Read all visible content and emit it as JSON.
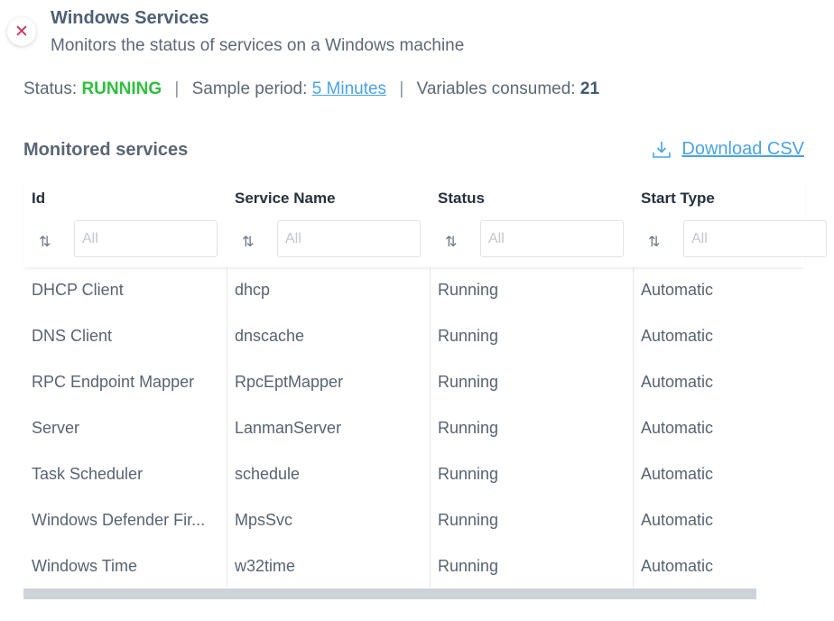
{
  "panel": {
    "title": "Windows Services",
    "subtitle": "Monitors the status of services on a Windows machine"
  },
  "status": {
    "status_label": "Status:",
    "status_value": "RUNNING",
    "separator": "|",
    "sample_label": "Sample period:",
    "sample_value": "5 Minutes",
    "variables_label": "Variables consumed:",
    "variables_value": "21"
  },
  "colors": {
    "running": "#2fbf3e",
    "link": "#4aa3e6",
    "close_icon": "#c9345b"
  },
  "section": {
    "title": "Monitored services",
    "download_label": "Download CSV",
    "download_icon": "download-icon"
  },
  "table": {
    "columns": [
      {
        "name": "Id",
        "filter_placeholder": "All"
      },
      {
        "name": "Service Name",
        "filter_placeholder": "All"
      },
      {
        "name": "Status",
        "filter_placeholder": "All"
      },
      {
        "name": "Start Type",
        "filter_placeholder": "All"
      }
    ],
    "rows": [
      [
        "DHCP Client",
        "dhcp",
        "Running",
        "Automatic"
      ],
      [
        "DNS Client",
        "dnscache",
        "Running",
        "Automatic"
      ],
      [
        "RPC Endpoint Mapper",
        "RpcEptMapper",
        "Running",
        "Automatic"
      ],
      [
        "Server",
        "LanmanServer",
        "Running",
        "Automatic"
      ],
      [
        "Task Scheduler",
        "schedule",
        "Running",
        "Automatic"
      ],
      [
        "Windows Defender Fir...",
        "MpsSvc",
        "Running",
        "Automatic"
      ],
      [
        "Windows Time",
        "w32time",
        "Running",
        "Automatic"
      ]
    ]
  }
}
